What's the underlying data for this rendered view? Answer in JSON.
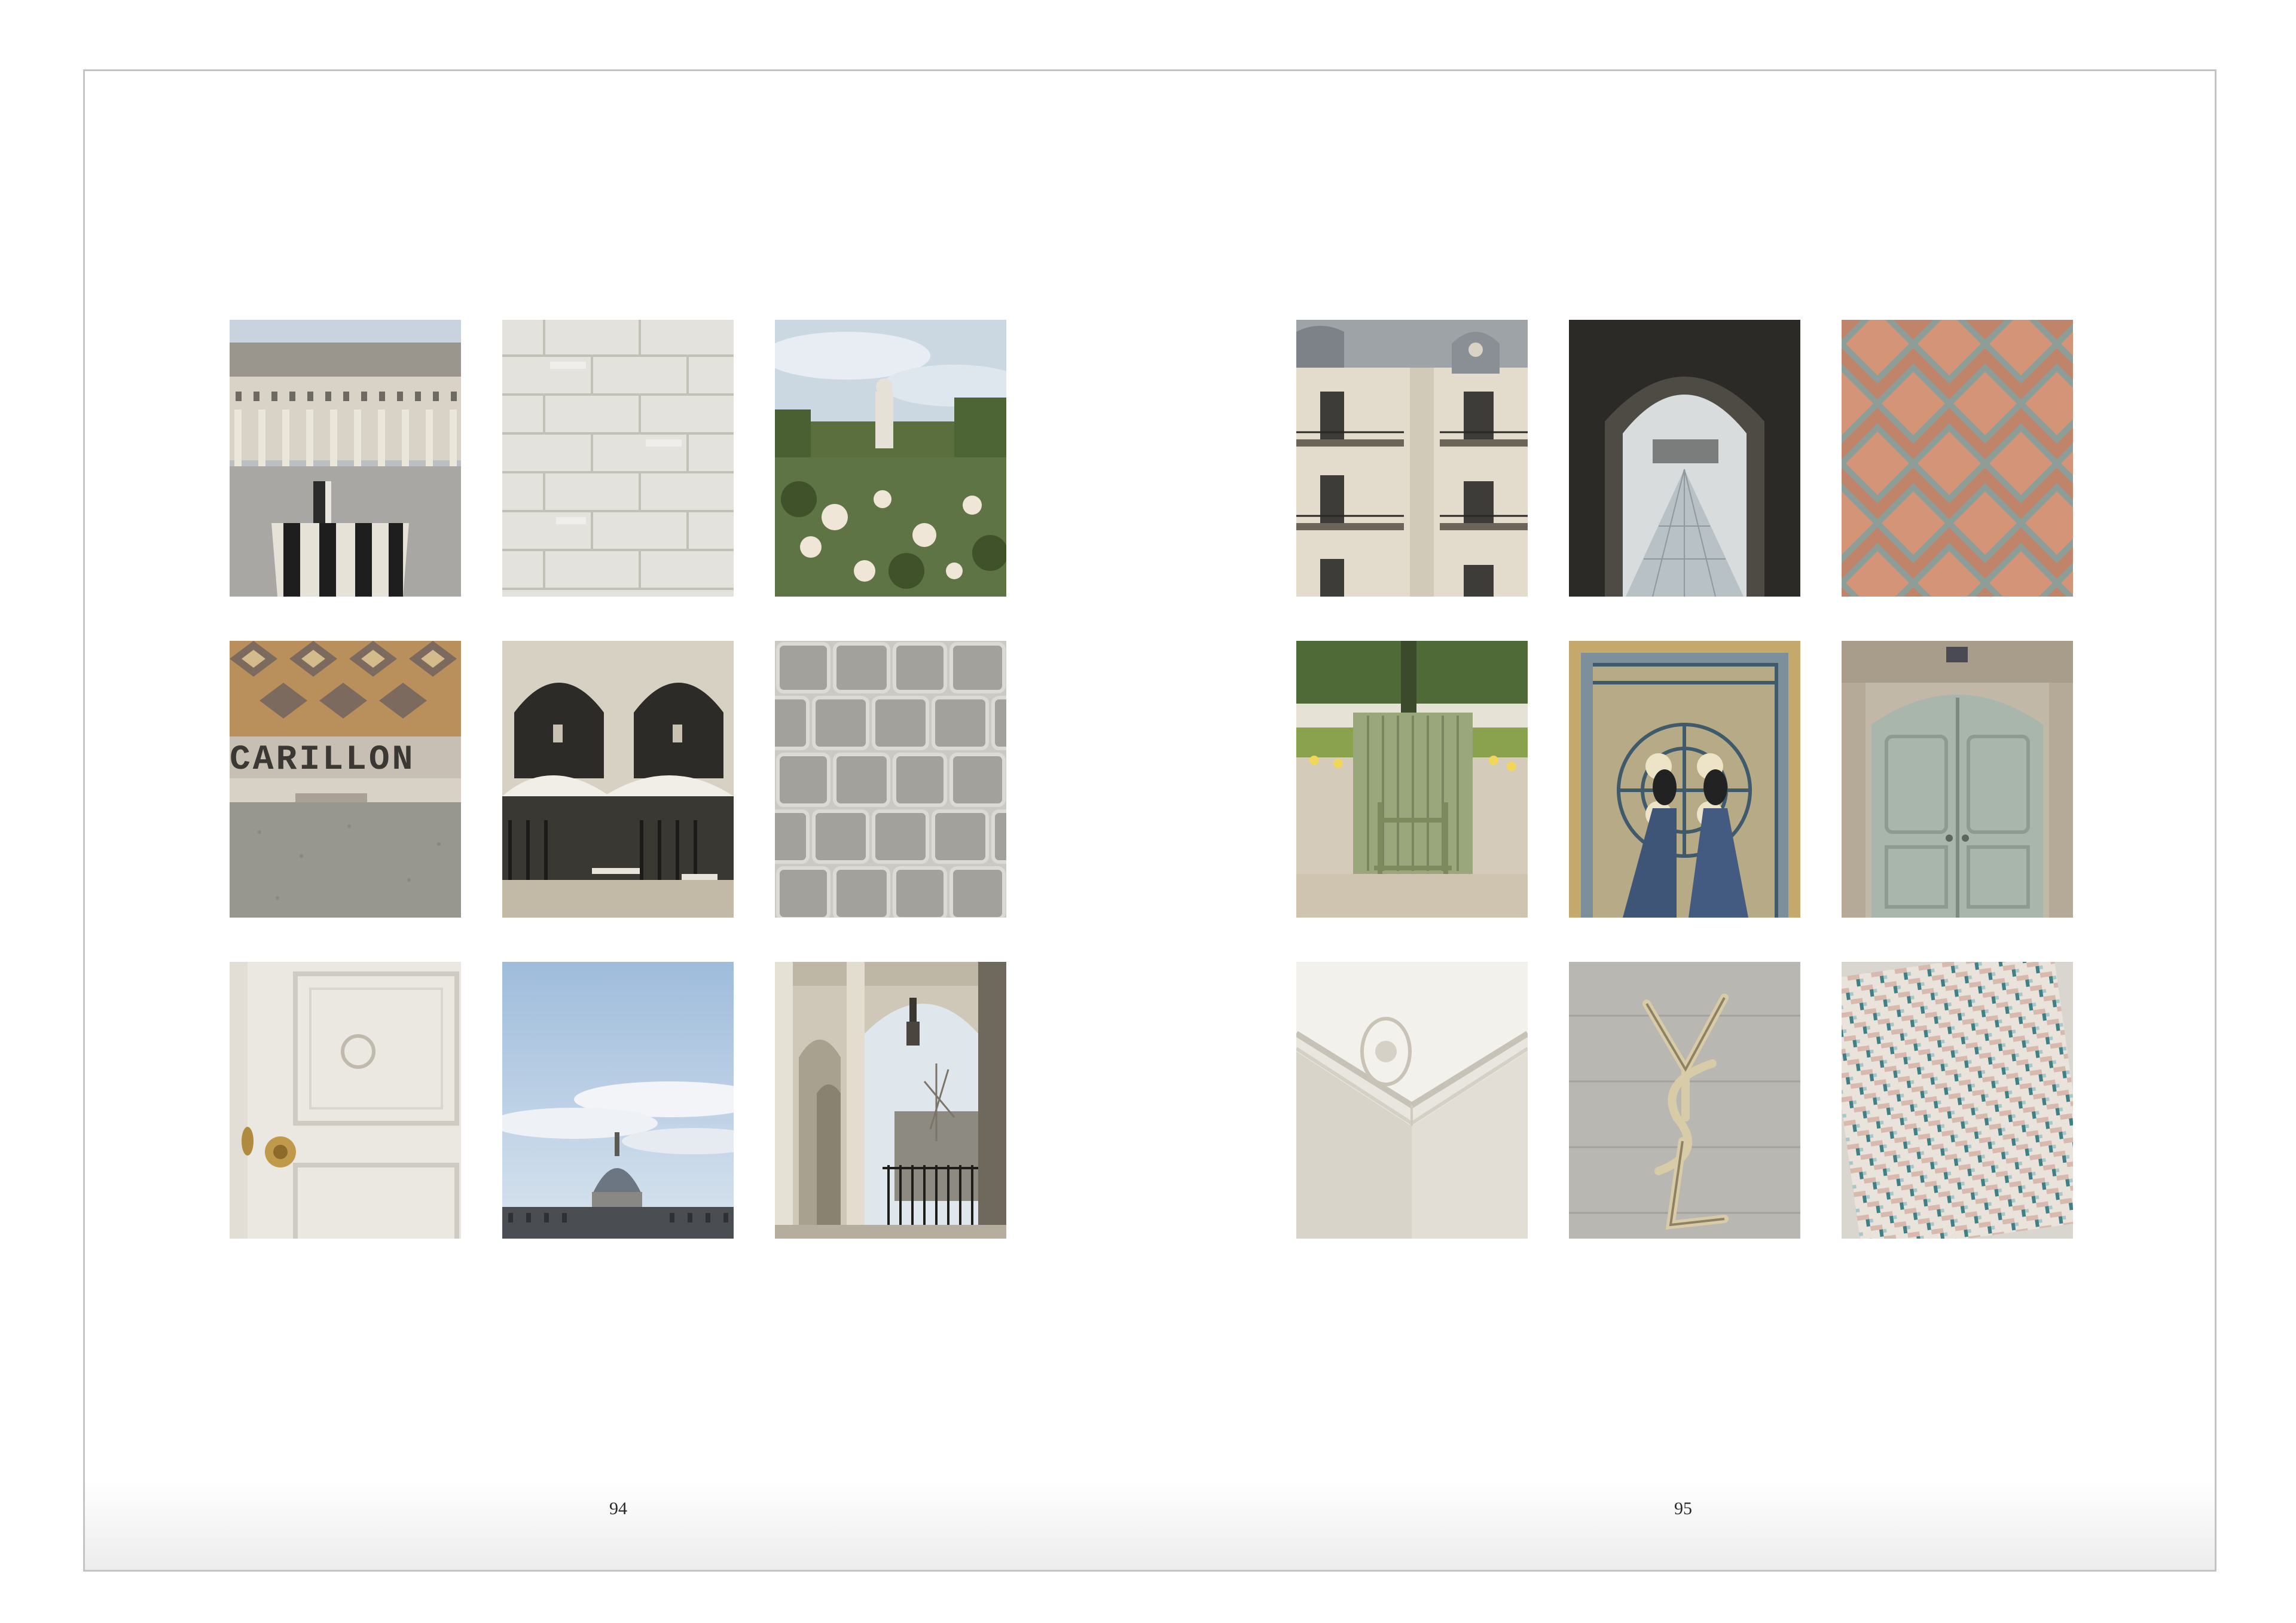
{
  "left_page": {
    "page_number": "94",
    "photos": [
      {
        "subject": "palais-royal-columns"
      },
      {
        "subject": "white-subway-tiles"
      },
      {
        "subject": "garden-statue-roses"
      },
      {
        "subject": "carillon-mosaic-floor",
        "sign_text": "CARILLON"
      },
      {
        "subject": "arcade-cafe-umbrellas"
      },
      {
        "subject": "cobblestone-wall"
      },
      {
        "subject": "white-door-brass-knob"
      },
      {
        "subject": "invalides-dome-sky"
      },
      {
        "subject": "colonnade-lantern"
      }
    ]
  },
  "right_page": {
    "page_number": "95",
    "photos": [
      {
        "subject": "haussmann-facade"
      },
      {
        "subject": "louvre-pyramid-arch"
      },
      {
        "subject": "terracotta-tile-floor"
      },
      {
        "subject": "green-garden-chair"
      },
      {
        "subject": "mosaic-floor-feet"
      },
      {
        "subject": "grey-green-door"
      },
      {
        "subject": "ceiling-molding"
      },
      {
        "subject": "ysl-logo-sign",
        "logo_text": "YSL"
      },
      {
        "subject": "woven-tile-pattern"
      }
    ]
  },
  "colors": {
    "frame_border": "#c4c4c4",
    "page_background": "#ffffff",
    "folio_text": "#2a2a2a"
  }
}
